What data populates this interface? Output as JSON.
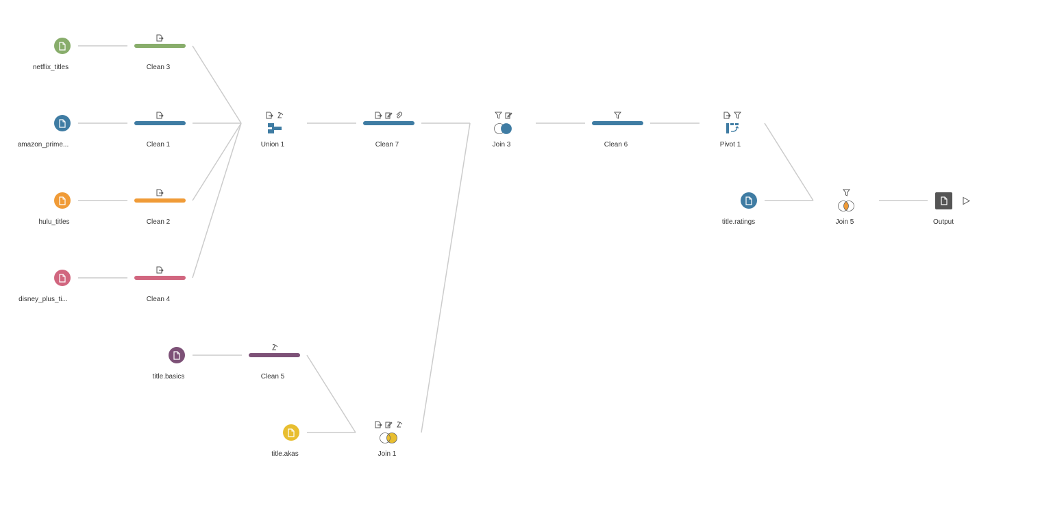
{
  "colors": {
    "green": "#88ad6b",
    "blue": "#3f7ca3",
    "orange": "#f09b37",
    "pink": "#d1667f",
    "purple": "#7d5177",
    "yellow": "#e8be30",
    "output": "#555555",
    "connector": "#cccccc"
  },
  "nodes": {
    "netflix_titles": {
      "label": "netflix_titles",
      "type": "input",
      "color": "green",
      "icon": "file-icon"
    },
    "amazon_prime": {
      "label": "amazon_prime...",
      "type": "input",
      "color": "blue",
      "icon": "file-icon"
    },
    "hulu_titles": {
      "label": "hulu_titles",
      "type": "input",
      "color": "orange",
      "icon": "file-icon"
    },
    "disney_plus": {
      "label": "disney_plus_ti...",
      "type": "input",
      "color": "pink",
      "icon": "file-icon"
    },
    "title_basics": {
      "label": "title.basics",
      "type": "input",
      "color": "purple",
      "icon": "file-icon"
    },
    "title_akas": {
      "label": "title.akas",
      "type": "input",
      "color": "yellow",
      "icon": "file-icon"
    },
    "title_ratings": {
      "label": "title.ratings",
      "type": "input",
      "color": "blue",
      "icon": "file-icon"
    },
    "clean3": {
      "label": "Clean 3",
      "type": "clean",
      "color": "green",
      "changes": [
        "rename-icon"
      ]
    },
    "clean1": {
      "label": "Clean 1",
      "type": "clean",
      "color": "blue",
      "changes": [
        "rename-icon"
      ]
    },
    "clean2": {
      "label": "Clean 2",
      "type": "clean",
      "color": "orange",
      "changes": [
        "rename-icon"
      ]
    },
    "clean4": {
      "label": "Clean 4",
      "type": "clean",
      "color": "pink",
      "changes": [
        "rename-icon"
      ]
    },
    "clean5": {
      "label": "Clean 5",
      "type": "clean",
      "color": "purple",
      "changes": [
        "calc-icon"
      ]
    },
    "union1": {
      "label": "Union 1",
      "type": "union",
      "color": "blue",
      "changes": [
        "rename-icon",
        "calc-icon"
      ]
    },
    "clean7": {
      "label": "Clean 7",
      "type": "clean",
      "color": "blue",
      "changes": [
        "rename-icon",
        "edit-icon",
        "attach-icon"
      ]
    },
    "join1": {
      "label": "Join 1",
      "type": "join",
      "color": "yellow",
      "join_side": "right",
      "changes": [
        "rename-icon",
        "edit-icon",
        "calc-icon"
      ]
    },
    "join3": {
      "label": "Join 3",
      "type": "join",
      "color": "blue",
      "join_side": "right",
      "changes": [
        "filter-icon",
        "edit-icon"
      ]
    },
    "clean6": {
      "label": "Clean 6",
      "type": "clean",
      "color": "blue",
      "changes": [
        "filter-icon"
      ]
    },
    "pivot1": {
      "label": "Pivot 1",
      "type": "pivot",
      "color": "blue",
      "changes": [
        "rename-icon",
        "filter-icon"
      ]
    },
    "join5": {
      "label": "Join 5",
      "type": "join",
      "color": "orange",
      "join_side": "inner",
      "changes": [
        "filter-icon"
      ]
    },
    "output": {
      "label": "Output",
      "type": "output",
      "color": "output",
      "icon": "file-icon",
      "run_icon": "play-icon"
    }
  }
}
